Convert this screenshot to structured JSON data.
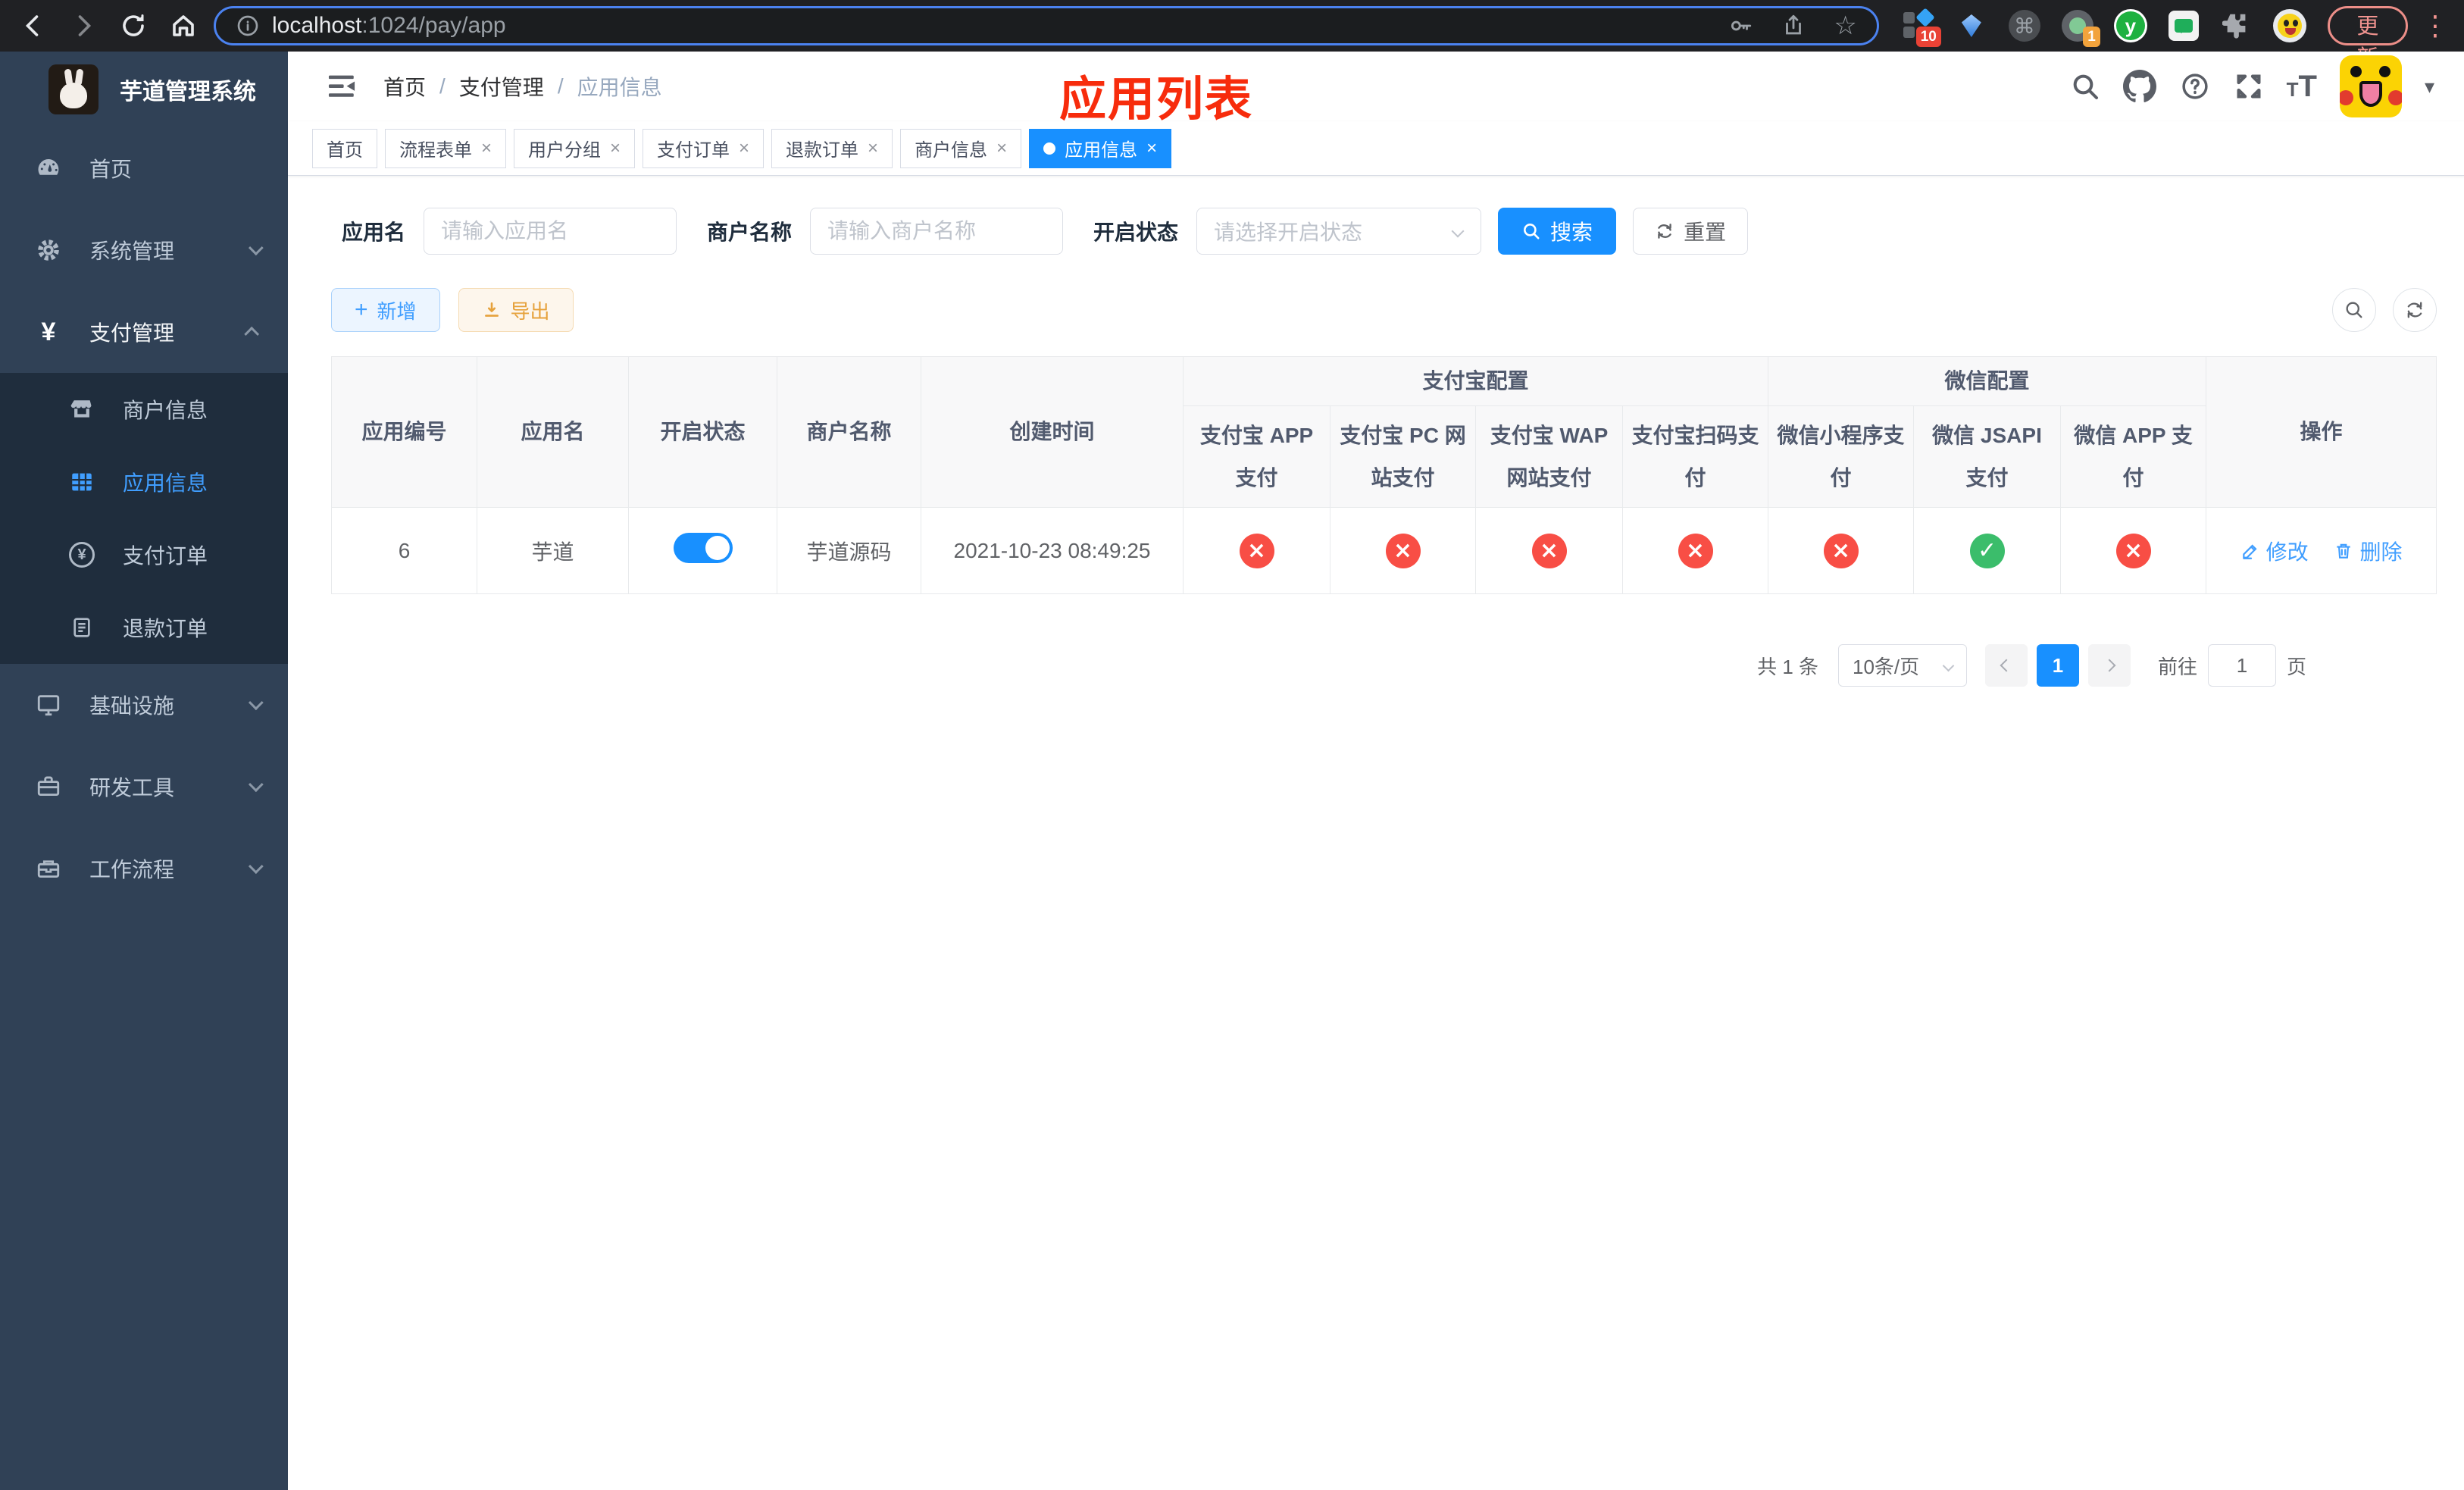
{
  "browser": {
    "url": {
      "host": "localhost",
      "path": ":1024/pay/app"
    },
    "update_label": "更新",
    "extensions": {
      "badge_a": "10",
      "badge_b": "1",
      "y_label": "y"
    }
  },
  "sidebar": {
    "title": "芋道管理系统",
    "items": [
      {
        "label": "首页"
      },
      {
        "label": "系统管理"
      },
      {
        "label": "支付管理",
        "children": [
          {
            "label": "商户信息"
          },
          {
            "label": "应用信息"
          },
          {
            "label": "支付订单"
          },
          {
            "label": "退款订单"
          }
        ]
      },
      {
        "label": "基础设施"
      },
      {
        "label": "研发工具"
      },
      {
        "label": "工作流程"
      }
    ]
  },
  "navbar": {
    "separator": "/",
    "breadcrumb": [
      {
        "label": "首页"
      },
      {
        "label": "支付管理"
      },
      {
        "label": "应用信息"
      }
    ]
  },
  "overlay_title": "应用列表",
  "tabs": [
    {
      "label": "首页"
    },
    {
      "label": "流程表单"
    },
    {
      "label": "用户分组"
    },
    {
      "label": "支付订单"
    },
    {
      "label": "退款订单"
    },
    {
      "label": "商户信息"
    },
    {
      "label": "应用信息"
    }
  ],
  "icons": {
    "close": "×",
    "caret": "▾",
    "dots": "⋮",
    "star": "☆",
    "plus": "+",
    "yen": "¥",
    "cmd": "⌘"
  },
  "filters": {
    "app_name_label": "应用名",
    "app_name_placeholder": "请输入应用名",
    "merchant_label": "商户名称",
    "merchant_placeholder": "请输入商户名称",
    "status_label": "开启状态",
    "status_placeholder": "请选择开启状态",
    "search_label": "搜索",
    "reset_label": "重置"
  },
  "toolbar": {
    "add_label": "新增",
    "export_label": "导出"
  },
  "table": {
    "groups": {
      "alipay": "支付宝配置",
      "wechat": "微信配置"
    },
    "columns": {
      "app_id": "应用编号",
      "app_name": "应用名",
      "status": "开启状态",
      "merchant": "商户名称",
      "created": "创建时间",
      "alipay_app": "支付宝 APP 支付",
      "alipay_pc": "支付宝 PC 网站支付",
      "alipay_wap": "支付宝 WAP 网站支付",
      "alipay_qr": "支付宝扫码支付",
      "wechat_lite": "微信小程序支付",
      "wechat_jsapi": "微信 JSAPI 支付",
      "wechat_app": "微信 APP 支付",
      "actions": "操作"
    },
    "row": {
      "app_id": "6",
      "app_name": "芋道",
      "enabled": true,
      "merchant": "芋道源码",
      "created": "2021-10-23 08:49:25",
      "channels": [
        {
          "name": "alipay-app",
          "status": "cross"
        },
        {
          "name": "alipay-pc",
          "status": "cross"
        },
        {
          "name": "alipay-wap",
          "status": "cross"
        },
        {
          "name": "alipay-qr",
          "status": "cross"
        },
        {
          "name": "wechat-lite",
          "status": "cross"
        },
        {
          "name": "wechat-jsapi",
          "status": "check"
        },
        {
          "name": "wechat-app",
          "status": "cross"
        }
      ],
      "edit_label": "修改",
      "delete_label": "删除"
    }
  },
  "pagination": {
    "total": "共 1 条",
    "page_size": "10条/页",
    "page": "1",
    "goto": "前往",
    "goto_value": "1",
    "unit": "页"
  }
}
